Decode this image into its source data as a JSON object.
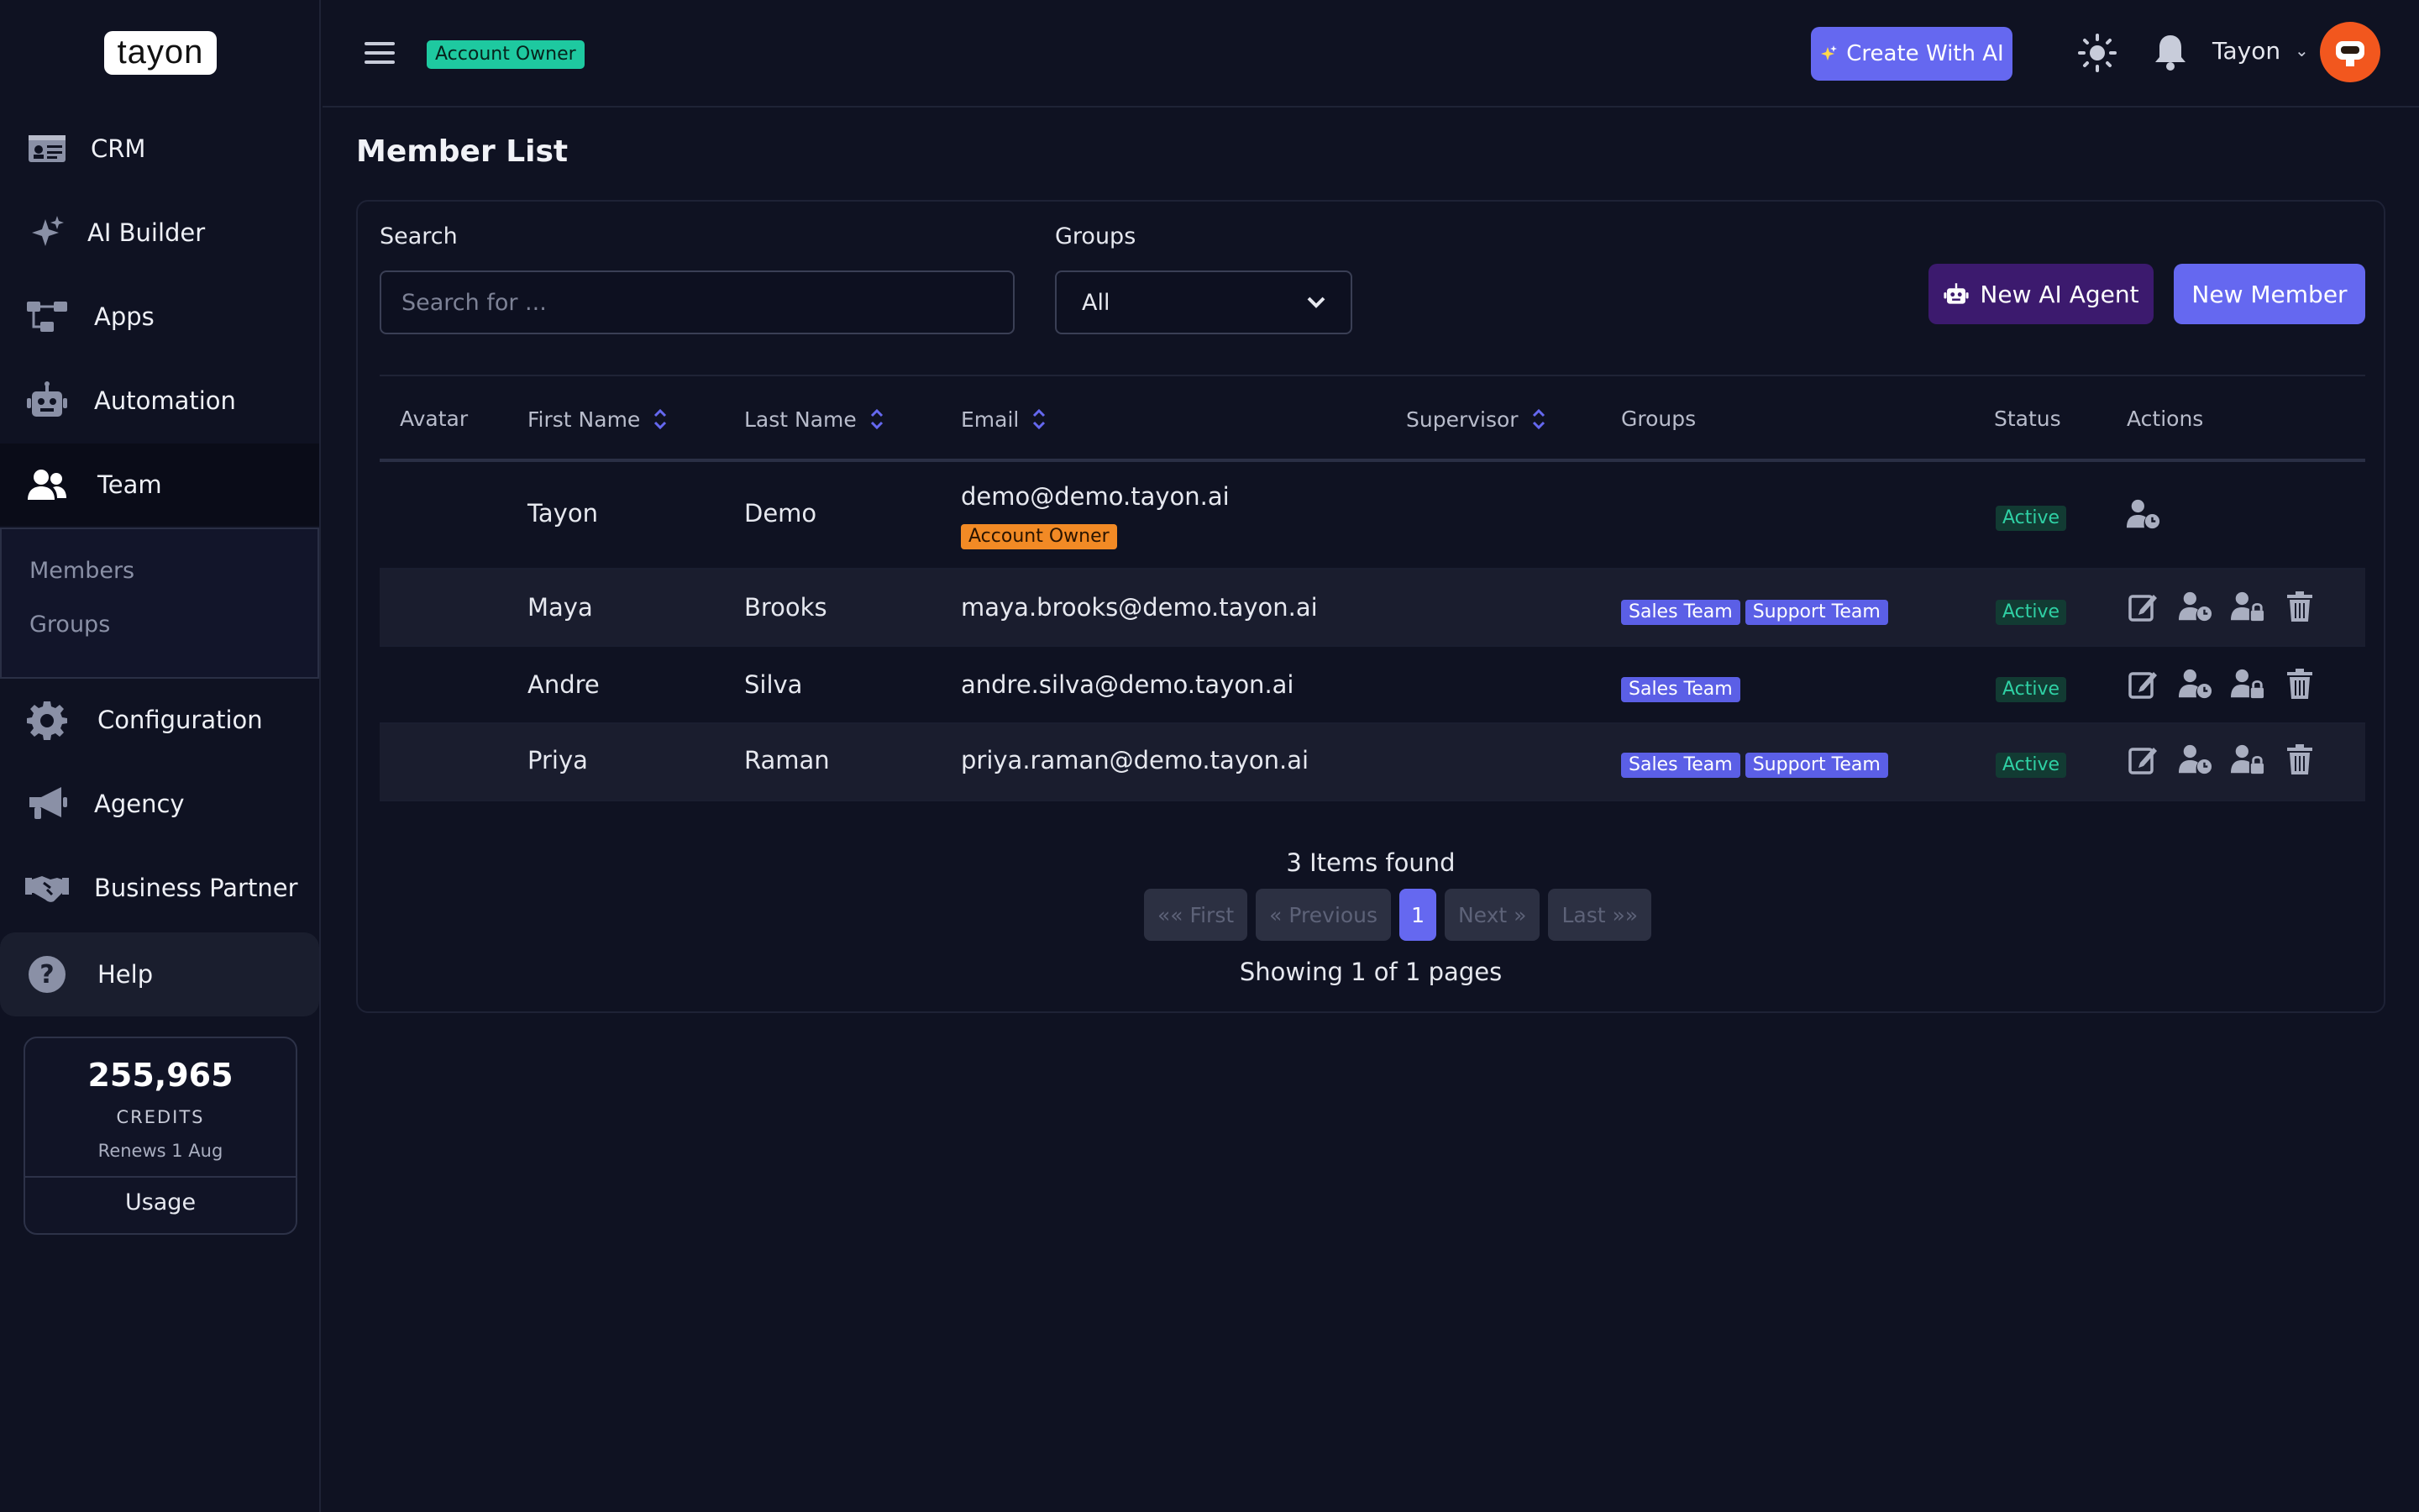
{
  "app": {
    "logo_text": "tayon"
  },
  "sidebar": {
    "items": [
      {
        "label": "CRM",
        "icon": "id-card-icon"
      },
      {
        "label": "AI Builder",
        "icon": "sparkles-icon"
      },
      {
        "label": "Apps",
        "icon": "flow-icon"
      },
      {
        "label": "Automation",
        "icon": "robot-icon"
      },
      {
        "label": "Team",
        "icon": "users-icon"
      },
      {
        "label": "Configuration",
        "icon": "gear-icon"
      },
      {
        "label": "Agency",
        "icon": "megaphone-icon"
      },
      {
        "label": "Business Partner",
        "icon": "handshake-icon"
      },
      {
        "label": "Help",
        "icon": "question-icon"
      }
    ],
    "team_sub": [
      "Members",
      "Groups"
    ],
    "credits": {
      "amount": "255,965",
      "label": "CREDITS",
      "renews": "Renews 1 Aug",
      "usage": "Usage"
    }
  },
  "header": {
    "role_badge": "Account Owner",
    "create_ai": "Create With AI",
    "user_name": "Tayon"
  },
  "main": {
    "title": "Member List",
    "search_label": "Search",
    "search_placeholder": "Search for ...",
    "groups_label": "Groups",
    "groups_selected": "All",
    "new_agent": "New AI Agent",
    "new_member": "New Member",
    "columns": [
      "Avatar",
      "First Name",
      "Last Name",
      "Email",
      "Supervisor",
      "Groups",
      "Status",
      "Actions"
    ],
    "rows": [
      {
        "first": "Tayon",
        "last": "Demo",
        "email": "demo@demo.tayon.ai",
        "badge": "Account Owner",
        "groups": [],
        "status": "Active"
      },
      {
        "first": "Maya",
        "last": "Brooks",
        "email": "maya.brooks@demo.tayon.ai",
        "groups": [
          "Sales Team",
          "Support Team"
        ],
        "status": "Active"
      },
      {
        "first": "Andre",
        "last": "Silva",
        "email": "andre.silva@demo.tayon.ai",
        "groups": [
          "Sales Team"
        ],
        "status": "Active"
      },
      {
        "first": "Priya",
        "last": "Raman",
        "email": "priya.raman@demo.tayon.ai",
        "groups": [
          "Sales Team",
          "Support Team"
        ],
        "status": "Active"
      }
    ],
    "items_found": "3 Items found",
    "pager": {
      "first": "«« First",
      "prev": "« Previous",
      "current": "1",
      "next": "Next »",
      "last": "Last »»"
    },
    "showing": "Showing 1 of 1 pages"
  },
  "colors": {
    "accent": "#6568f0",
    "background": "#0f1222",
    "success": "#2fd0a4",
    "owner": "#f28a25"
  }
}
